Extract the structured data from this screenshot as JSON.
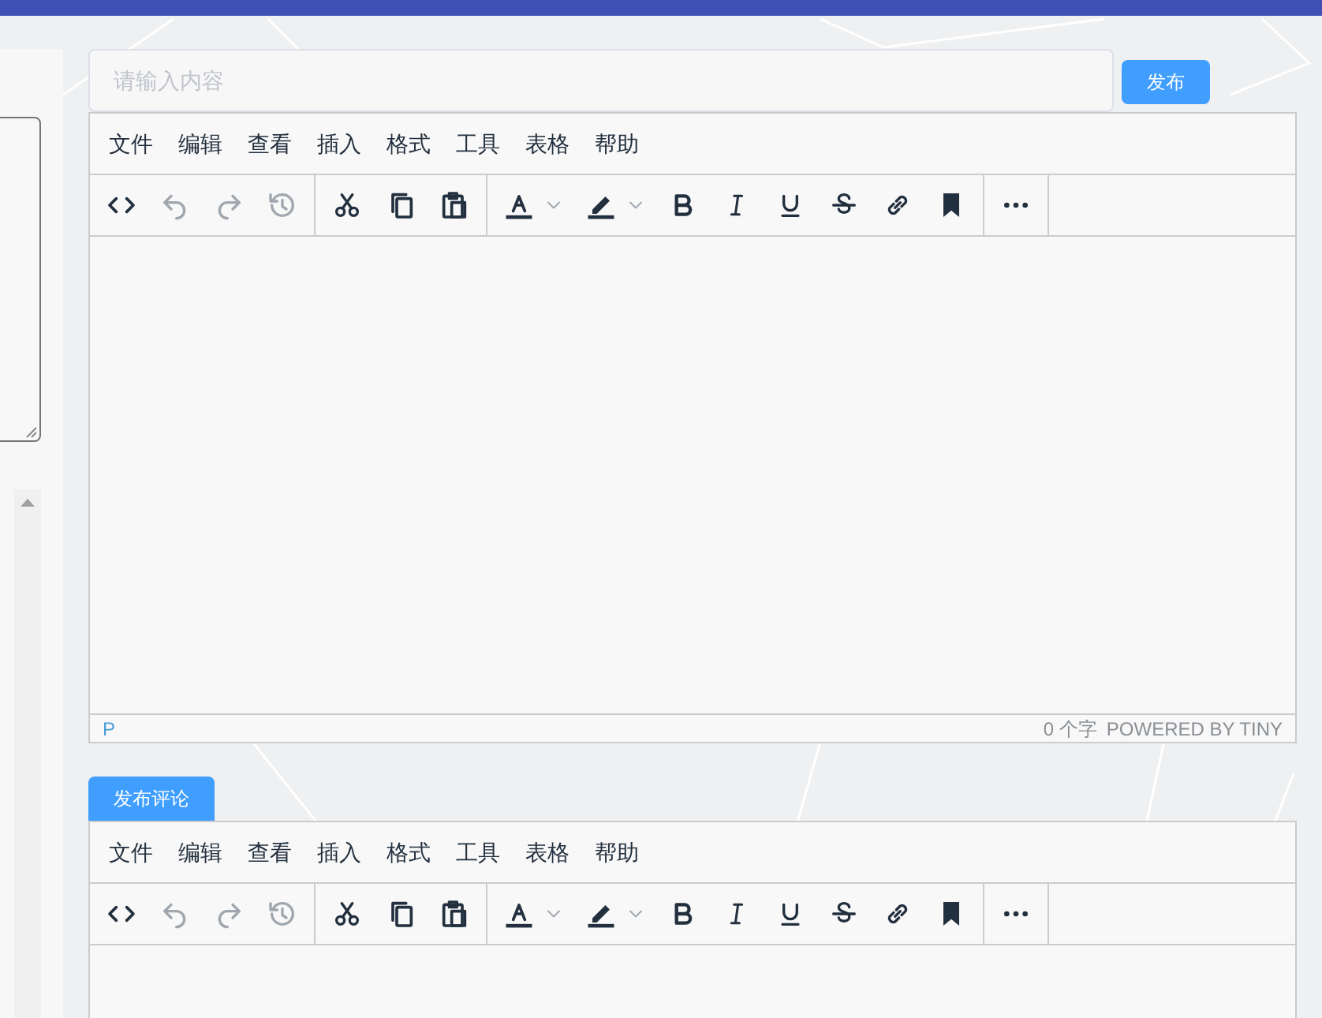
{
  "post_form": {
    "input": {
      "placeholder": "请输入内容"
    },
    "submit_button": "发布"
  },
  "editors": [
    {
      "menu": [
        {
          "label": "文件"
        },
        {
          "label": "编辑"
        },
        {
          "label": "查看"
        },
        {
          "label": "插入"
        },
        {
          "label": "格式"
        },
        {
          "label": "工具"
        },
        {
          "label": "表格"
        },
        {
          "label": "帮助"
        }
      ],
      "toolbar": [
        [
          {
            "kind": "code",
            "disabled": false
          },
          {
            "kind": "undo",
            "disabled": true
          },
          {
            "kind": "redo",
            "disabled": true
          },
          {
            "kind": "history",
            "disabled": true
          }
        ],
        [
          {
            "kind": "cut",
            "disabled": false
          },
          {
            "kind": "copy",
            "disabled": false
          },
          {
            "kind": "paste",
            "disabled": false
          }
        ],
        [
          {
            "kind": "textcolor",
            "disabled": false
          },
          {
            "kind": "highlight",
            "disabled": false
          },
          {
            "kind": "bold",
            "disabled": false
          },
          {
            "kind": "italic",
            "disabled": false
          },
          {
            "kind": "underline",
            "disabled": false
          },
          {
            "kind": "strike",
            "disabled": false
          },
          {
            "kind": "link",
            "disabled": false
          },
          {
            "kind": "bookmark",
            "disabled": false
          }
        ],
        [
          {
            "kind": "more",
            "disabled": false
          }
        ]
      ],
      "status_bar": {
        "path": "P",
        "word_count": "0 个字",
        "branding": "POWERED BY TINY"
      }
    },
    {
      "heading_button": "发布评论",
      "menu": [
        {
          "label": "文件"
        },
        {
          "label": "编辑"
        },
        {
          "label": "查看"
        },
        {
          "label": "插入"
        },
        {
          "label": "格式"
        },
        {
          "label": "工具"
        },
        {
          "label": "表格"
        },
        {
          "label": "帮助"
        }
      ],
      "toolbar": [
        [
          {
            "kind": "code",
            "disabled": false
          },
          {
            "kind": "undo",
            "disabled": true
          },
          {
            "kind": "redo",
            "disabled": true
          },
          {
            "kind": "history",
            "disabled": true
          }
        ],
        [
          {
            "kind": "cut",
            "disabled": false
          },
          {
            "kind": "copy",
            "disabled": false
          },
          {
            "kind": "paste",
            "disabled": false
          }
        ],
        [
          {
            "kind": "textcolor",
            "disabled": false
          },
          {
            "kind": "highlight",
            "disabled": false
          },
          {
            "kind": "bold",
            "disabled": false
          },
          {
            "kind": "italic",
            "disabled": false
          },
          {
            "kind": "underline",
            "disabled": false
          },
          {
            "kind": "strike",
            "disabled": false
          },
          {
            "kind": "link",
            "disabled": false
          },
          {
            "kind": "bookmark",
            "disabled": false
          }
        ],
        [
          {
            "kind": "more",
            "disabled": false
          }
        ]
      ]
    }
  ]
}
